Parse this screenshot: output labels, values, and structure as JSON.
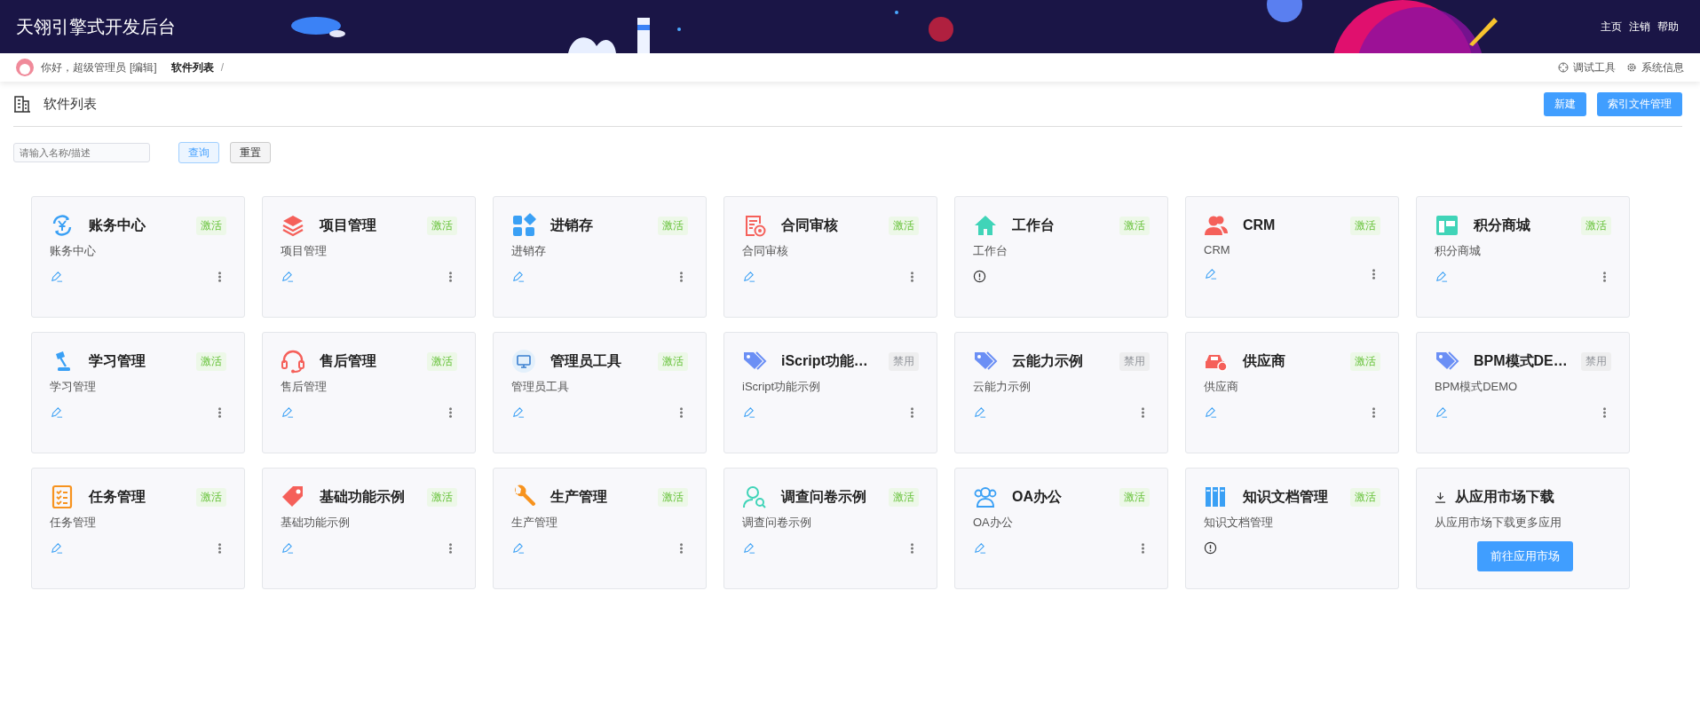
{
  "header": {
    "title": "天翎引擎式开发后台",
    "links": [
      "主页",
      "注销",
      "帮助"
    ]
  },
  "breadcrumb": {
    "greeting": "你好，超级管理员",
    "edit_link": "[编辑]",
    "current": "软件列表",
    "separator": "/",
    "tools": [
      "调试工具",
      "系统信息"
    ]
  },
  "page": {
    "title": "软件列表",
    "buttons": [
      "新建",
      "索引文件管理"
    ]
  },
  "search": {
    "placeholder": "请输入名称/描述",
    "buttons": [
      "查询",
      "重置"
    ]
  },
  "cards": [
    {
      "kind": "editable",
      "title": "账务中心",
      "status": "激活",
      "active": true,
      "description": "账务中心"
    },
    {
      "kind": "editable",
      "title": "项目管理",
      "status": "激活",
      "active": true,
      "description": "项目管理"
    },
    {
      "kind": "editable",
      "title": "进销存",
      "status": "激活",
      "active": true,
      "description": "进销存"
    },
    {
      "kind": "editable",
      "title": "合同审核",
      "status": "激活",
      "active": true,
      "description": "合同审核"
    },
    {
      "kind": "warning",
      "title": "工作台",
      "status": "激活",
      "active": true,
      "description": "工作台"
    },
    {
      "kind": "editable",
      "title": "CRM",
      "status": "激活",
      "active": true,
      "description": "CRM"
    },
    {
      "kind": "editable",
      "title": "积分商城",
      "status": "激活",
      "active": true,
      "description": "积分商城"
    },
    {
      "kind": "editable",
      "title": "学习管理",
      "status": "激活",
      "active": true,
      "description": "学习管理"
    },
    {
      "kind": "editable",
      "title": "售后管理",
      "status": "激活",
      "active": true,
      "description": "售后管理"
    },
    {
      "kind": "editable",
      "title": "管理员工具",
      "status": "激活",
      "active": true,
      "description": "管理员工具"
    },
    {
      "kind": "editable",
      "title": "iScript功能…",
      "status": "禁用",
      "active": false,
      "description": "iScript功能示例"
    },
    {
      "kind": "editable",
      "title": "云能力示例",
      "status": "禁用",
      "active": false,
      "description": "云能力示例"
    },
    {
      "kind": "editable",
      "title": "供应商",
      "status": "激活",
      "active": true,
      "description": "供应商"
    },
    {
      "kind": "editable",
      "title": "BPM模式DE…",
      "status": "禁用",
      "active": false,
      "description": "BPM模式DEMO"
    },
    {
      "kind": "editable",
      "title": "任务管理",
      "status": "激活",
      "active": true,
      "description": "任务管理"
    },
    {
      "kind": "editable",
      "title": "基础功能示例",
      "status": "激活",
      "active": true,
      "description": "基础功能示例"
    },
    {
      "kind": "editable",
      "title": "生产管理",
      "status": "激活",
      "active": true,
      "description": "生产管理"
    },
    {
      "kind": "editable",
      "title": "调查问卷示例",
      "status": "激活",
      "active": true,
      "description": "调查问卷示例"
    },
    {
      "kind": "editable",
      "title": "OA办公",
      "status": "激活",
      "active": true,
      "description": "OA办公"
    },
    {
      "kind": "warning",
      "title": "知识文档管理",
      "status": "激活",
      "active": true,
      "description": "知识文档管理"
    },
    {
      "kind": "market",
      "title": "从应用市场下载",
      "description": "从应用市场下载更多应用",
      "button": "前往应用市场"
    }
  ]
}
